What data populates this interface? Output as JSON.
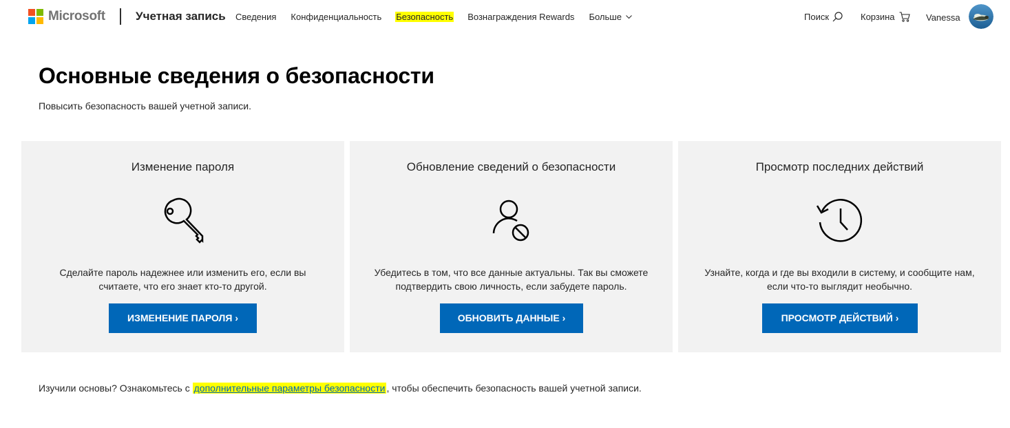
{
  "header": {
    "logo_text": "Microsoft",
    "logo_colors": [
      "#f25022",
      "#7fba00",
      "#00a4ef",
      "#ffb900"
    ],
    "account_title": "Учетная запись",
    "nav": [
      {
        "label": "Сведения",
        "active": false
      },
      {
        "label": "Конфиденциальность",
        "active": false
      },
      {
        "label": "Безопасность",
        "active": true
      },
      {
        "label": "Вознаграждения Rewards",
        "active": false
      },
      {
        "label": "Больше",
        "active": false
      }
    ],
    "search_label": "Поиск",
    "cart_label": "Корзина",
    "user_name": "Vanessa"
  },
  "page": {
    "title": "Основные сведения о безопасности",
    "subtitle": "Повысить безопасность вашей учетной записи."
  },
  "cards": [
    {
      "title": "Изменение пароля",
      "icon": "key-icon",
      "description": "Сделайте пароль надежнее или изменить его, если вы считаете, что его знает кто-то другой.",
      "button": "ИЗМЕНЕНИЕ ПАРОЛЯ ›"
    },
    {
      "title": "Обновление сведений о безопасности",
      "icon": "user-block-icon",
      "description": "Убедитесь в том, что все данные актуальны. Так вы сможете подтвердить свою личность, если забудете пароль.",
      "button": "ОБНОВИТЬ ДАННЫЕ ›"
    },
    {
      "title": "Просмотр последних действий",
      "icon": "history-icon",
      "description": "Узнайте, когда и где вы входили в систему, и сообщите нам, если что-то выглядит необычно.",
      "button": "ПРОСМОТР ДЕЙСТВИЙ ›"
    }
  ],
  "footer": {
    "prefix": "Изучили основы? Ознакомьтесь с ",
    "link": "дополнительные параметры безопасности",
    "suffix": ", чтобы обеспечить безопасность вашей учетной записи."
  },
  "colors": {
    "accent": "#0067b8",
    "card_bg": "#f2f2f2",
    "highlight": "#ffff00"
  }
}
